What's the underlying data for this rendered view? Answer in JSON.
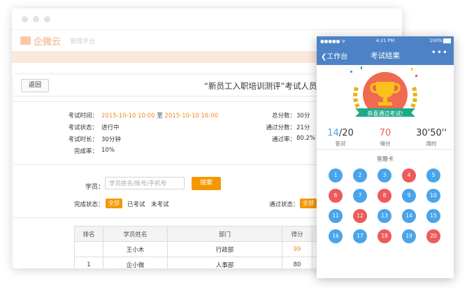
{
  "brand": {
    "name": "企微云",
    "subtitle": "管理平台"
  },
  "page": {
    "back_label": "返回",
    "title": "“新员工入职培训测评”考试人员明",
    "info": {
      "time_label": "考试时间：",
      "time_start": "2015-10-10 10:00",
      "time_to": "至",
      "time_end": "2015-10-10 16:00",
      "status_label": "考试状态：",
      "status_value": "进行中",
      "duration_label": "考试时长：",
      "duration_value": "30分钟",
      "completion_label": "完成率：",
      "completion_value": "10%",
      "total_label": "总分数：",
      "total_value": "30分",
      "pass_score_label": "通过分数：",
      "pass_score_value": "21分",
      "pass_rate_label": "通过率：",
      "pass_rate_value": "80.2%"
    },
    "search": {
      "label": "学员：",
      "placeholder": "学员姓名/账号/手机号",
      "button": "搜索"
    },
    "filter": {
      "completion_label": "完成状态：",
      "all": "全部",
      "done": "已考试",
      "not_done": "未考试",
      "pass_label": "通过状态：",
      "pass_all": "全部"
    },
    "table": {
      "headers": [
        "排名",
        "学员姓名",
        "部门",
        "得分",
        ""
      ],
      "rows": [
        {
          "rank": "",
          "name": "王小木",
          "dept": "行政部",
          "score": "99"
        },
        {
          "rank": "1",
          "name": "企小微",
          "dept": "人事部",
          "score": "80"
        }
      ]
    }
  },
  "phone": {
    "nav": {
      "back": "工作台",
      "title": "考试结果",
      "more": "•••"
    },
    "status_bar": {
      "time": "4:21 PM",
      "battery": "100%"
    },
    "trophy": {
      "banner": "恭喜通过考试!"
    },
    "stats": {
      "correct": "14",
      "total": "/20",
      "correct_label": "答对",
      "score": "70",
      "score_label": "得分",
      "time": "30'50''",
      "time_label": "用时"
    },
    "answer_card": {
      "title": "答题卡",
      "questions": [
        {
          "n": "1",
          "ok": true
        },
        {
          "n": "2",
          "ok": true
        },
        {
          "n": "3",
          "ok": true
        },
        {
          "n": "4",
          "ok": false
        },
        {
          "n": "5",
          "ok": true
        },
        {
          "n": "6",
          "ok": false
        },
        {
          "n": "7",
          "ok": true
        },
        {
          "n": "8",
          "ok": false
        },
        {
          "n": "9",
          "ok": true
        },
        {
          "n": "10",
          "ok": true
        },
        {
          "n": "11",
          "ok": true
        },
        {
          "n": "12",
          "ok": false
        },
        {
          "n": "13",
          "ok": true
        },
        {
          "n": "14",
          "ok": true
        },
        {
          "n": "15",
          "ok": true
        },
        {
          "n": "16",
          "ok": true
        },
        {
          "n": "17",
          "ok": true
        },
        {
          "n": "18",
          "ok": false
        },
        {
          "n": "19",
          "ok": true
        },
        {
          "n": "20",
          "ok": false
        }
      ]
    }
  },
  "colors": {
    "accent": "#f39800",
    "nav_blue": "#4d83c6",
    "correct": "#4aa4e9",
    "wrong": "#ee5a5a",
    "trophy_gold": "#f5b81d"
  }
}
